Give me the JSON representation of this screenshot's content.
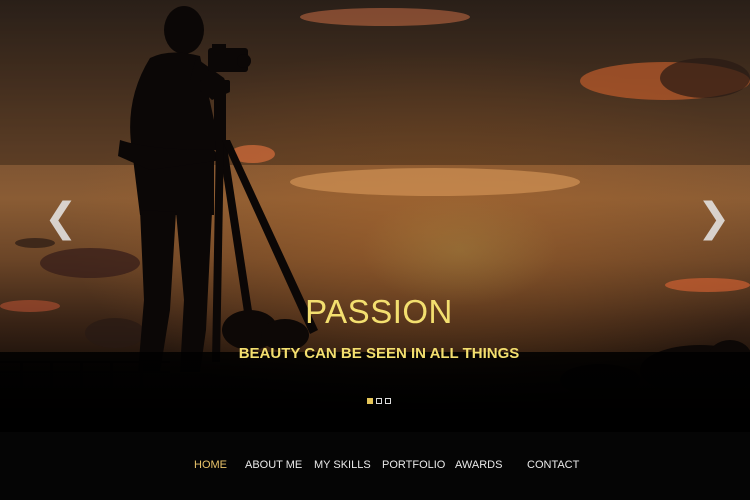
{
  "slider": {
    "title": "PASSION",
    "subtitle": "BEAUTY CAN BE SEEN IN ALL THINGS",
    "prev_icon": "❮",
    "next_icon": "❯",
    "indicator_count": 3,
    "active_index": 0
  },
  "nav": {
    "items": [
      {
        "label": "HOME",
        "active": true
      },
      {
        "label": "ABOUT ME",
        "active": false
      },
      {
        "label": "MY SKILLS",
        "active": false
      },
      {
        "label": "PORTFOLIO",
        "active": false
      },
      {
        "label": "AWARDS",
        "active": false
      },
      {
        "label": "CONTACT",
        "active": false
      }
    ]
  },
  "colors": {
    "caption": "#f3df6f",
    "nav_active": "#e9c36a",
    "nav_text": "#e9e9e9",
    "nav_background": "#050505"
  }
}
